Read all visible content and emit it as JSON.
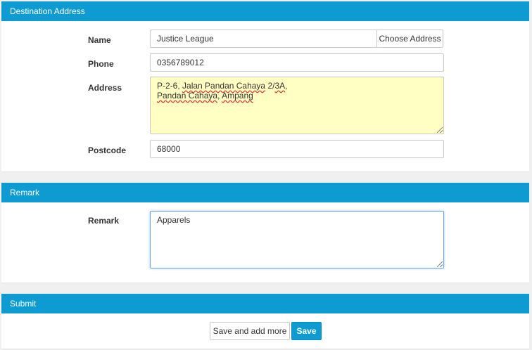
{
  "destination": {
    "heading": "Destination Address",
    "name_label": "Name",
    "name_value": "Justice League",
    "choose_address_label": "Choose Address",
    "phone_label": "Phone",
    "phone_value": "0356789012",
    "address_label": "Address",
    "address_line1_a": "P-2-6, ",
    "address_line1_b": "Jalan Pandan Cahaya",
    "address_line1_c": " 2/",
    "address_line1_d": "3A",
    "address_line1_e": ",",
    "address_line2_a": "Pandan Cahaya",
    "address_line2_b": ", ",
    "address_line2_c": "Ampang",
    "postcode_label": "Postcode",
    "postcode_value": "68000"
  },
  "remark": {
    "heading": "Remark",
    "remark_label": "Remark",
    "remark_value": "Apparels"
  },
  "submit": {
    "heading": "Submit",
    "save_and_add_more_label": "Save and add more",
    "save_label": "Save"
  },
  "colors": {
    "header_blue": "#0e9bd1",
    "address_bg": "#ffffc4"
  }
}
